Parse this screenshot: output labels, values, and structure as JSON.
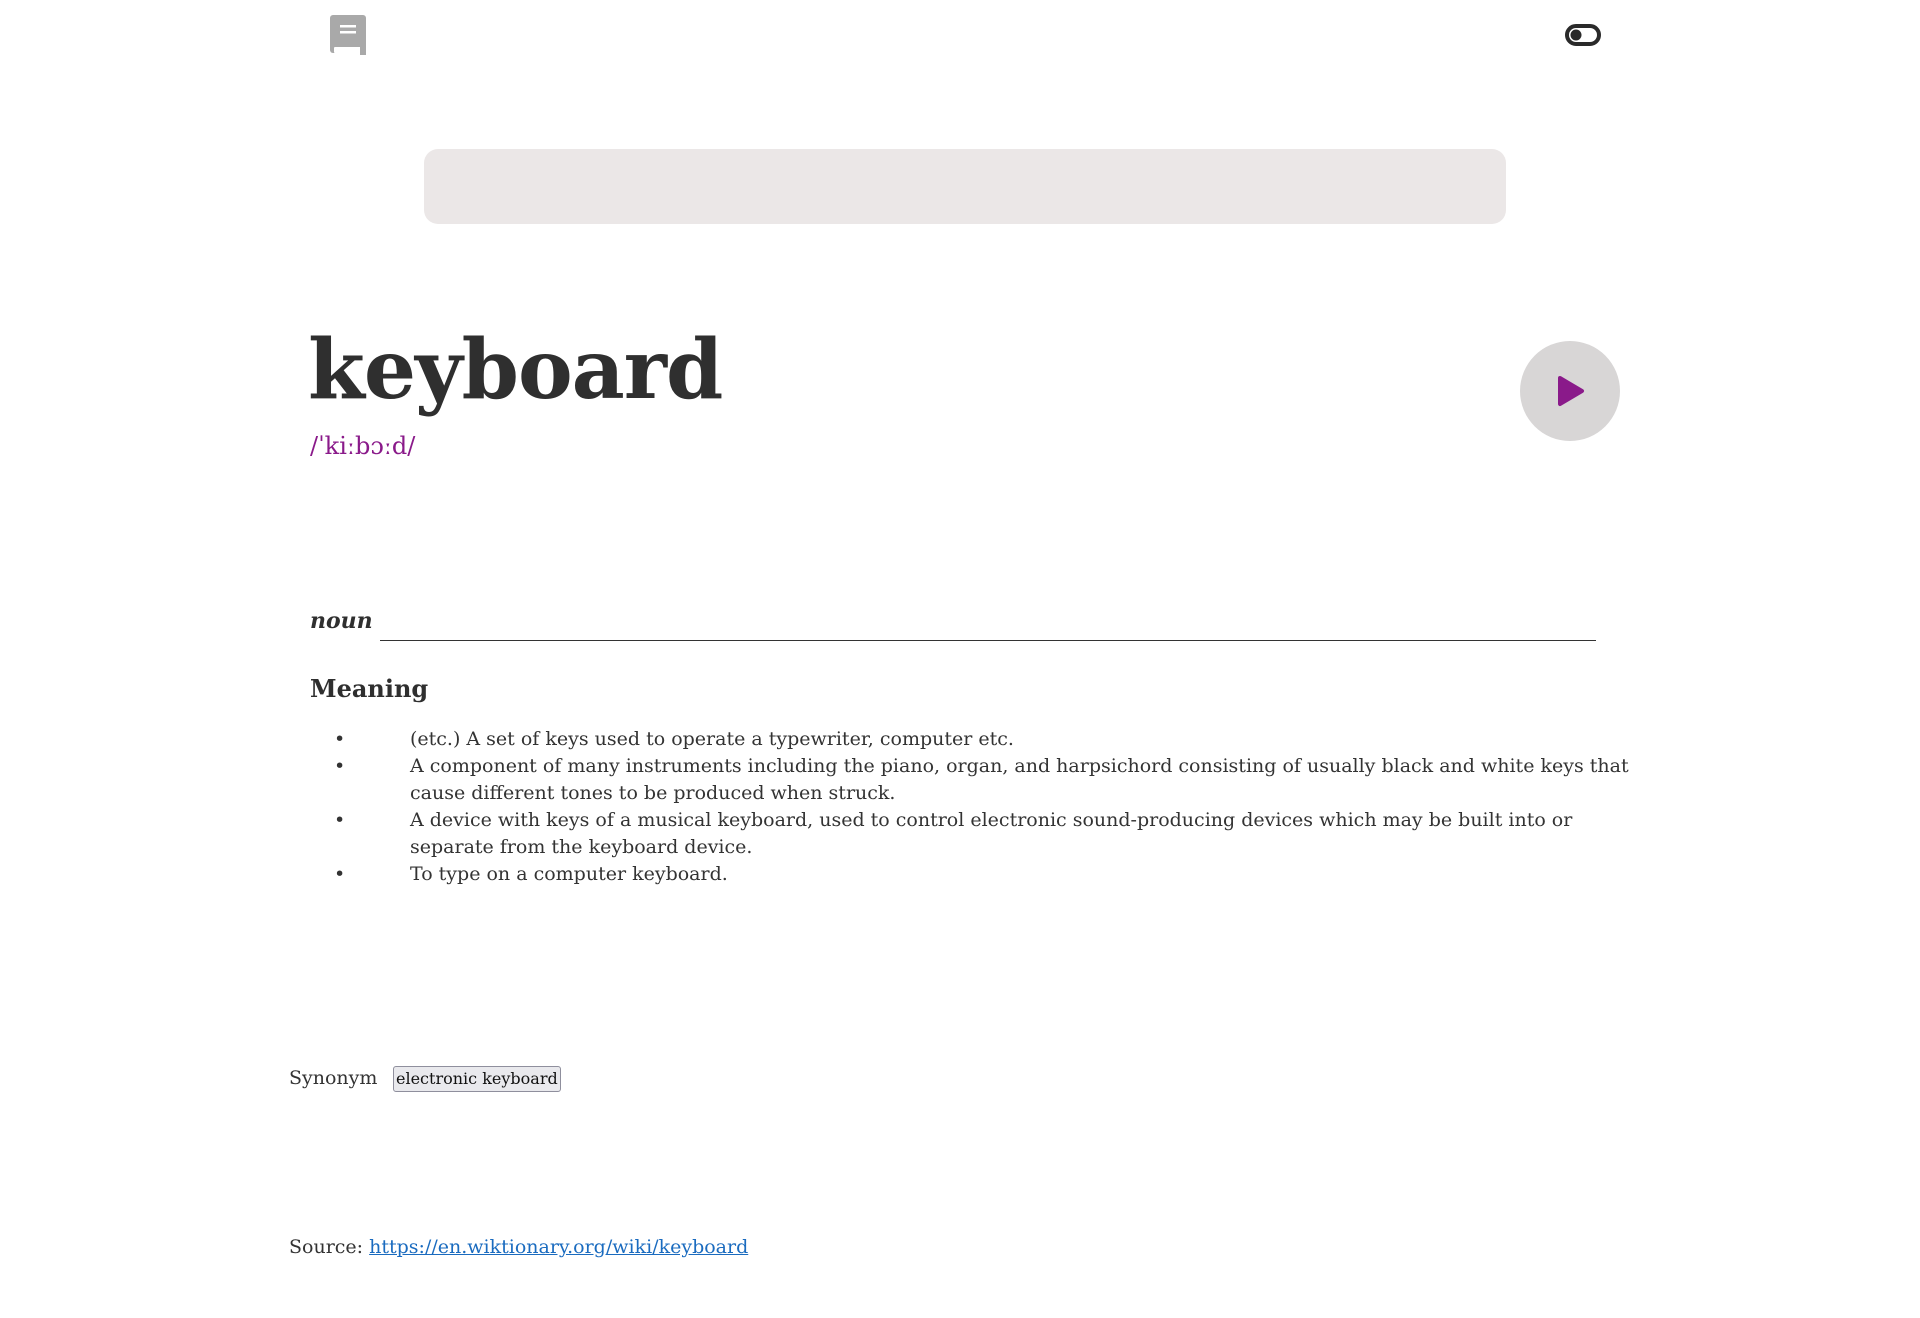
{
  "header": {
    "logo_icon": "book-icon",
    "theme_toggle_icon": "toggle-icon"
  },
  "search": {
    "value": "",
    "placeholder": ""
  },
  "entry": {
    "word": "keyboard",
    "phonetic": "/ˈkiːbɔːd/",
    "play_icon": "play-icon",
    "accent_color": "#8a1a8a"
  },
  "meanings": [
    {
      "part_of_speech": "noun",
      "heading": "Meaning",
      "definitions": [
        "(etc.) A set of keys used to operate a typewriter, computer etc.",
        "A component of many instruments including the piano, organ, and harpsichord consisting of usually black and white keys that cause different tones to be produced when struck.",
        "A device with keys of a musical keyboard, used to control electronic sound-producing devices which may be built into or separate from the keyboard device.",
        "To type on a computer keyboard."
      ],
      "synonym_label": "Synonym",
      "synonyms": [
        "electronic keyboard"
      ]
    }
  ],
  "source": {
    "label": "Source:",
    "url": "https://en.wiktionary.org/wiki/keyboard"
  }
}
